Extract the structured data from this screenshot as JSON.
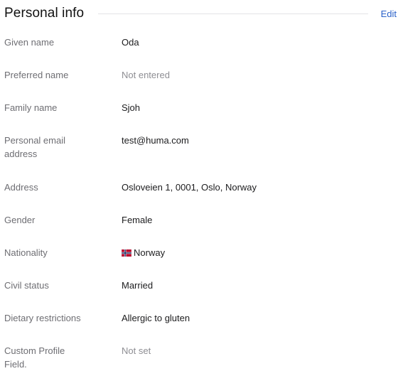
{
  "header": {
    "title": "Personal info",
    "edit_label": "Edit"
  },
  "fields": [
    {
      "label": "Given name",
      "value": "Oda"
    },
    {
      "label": "Preferred name",
      "value": "Not entered"
    },
    {
      "label": "Family name",
      "value": "Sjoh"
    },
    {
      "label": "Personal email address",
      "value": "test@huma.com"
    },
    {
      "label": "Address",
      "value": "Osloveien 1, 0001, Oslo, Norway"
    },
    {
      "label": "Gender",
      "value": "Female"
    },
    {
      "label": "Nationality",
      "value": "Norway",
      "icon": "norway-flag-icon"
    },
    {
      "label": "Civil status",
      "value": "Married"
    },
    {
      "label": "Dietary restrictions",
      "value": "Allergic to gluten"
    },
    {
      "label": "Custom Profile Field.",
      "value": "Not set"
    }
  ],
  "colors": {
    "accent": "#2a61c9",
    "label": "#6e6e73",
    "muted_value": "#8e8e93"
  }
}
